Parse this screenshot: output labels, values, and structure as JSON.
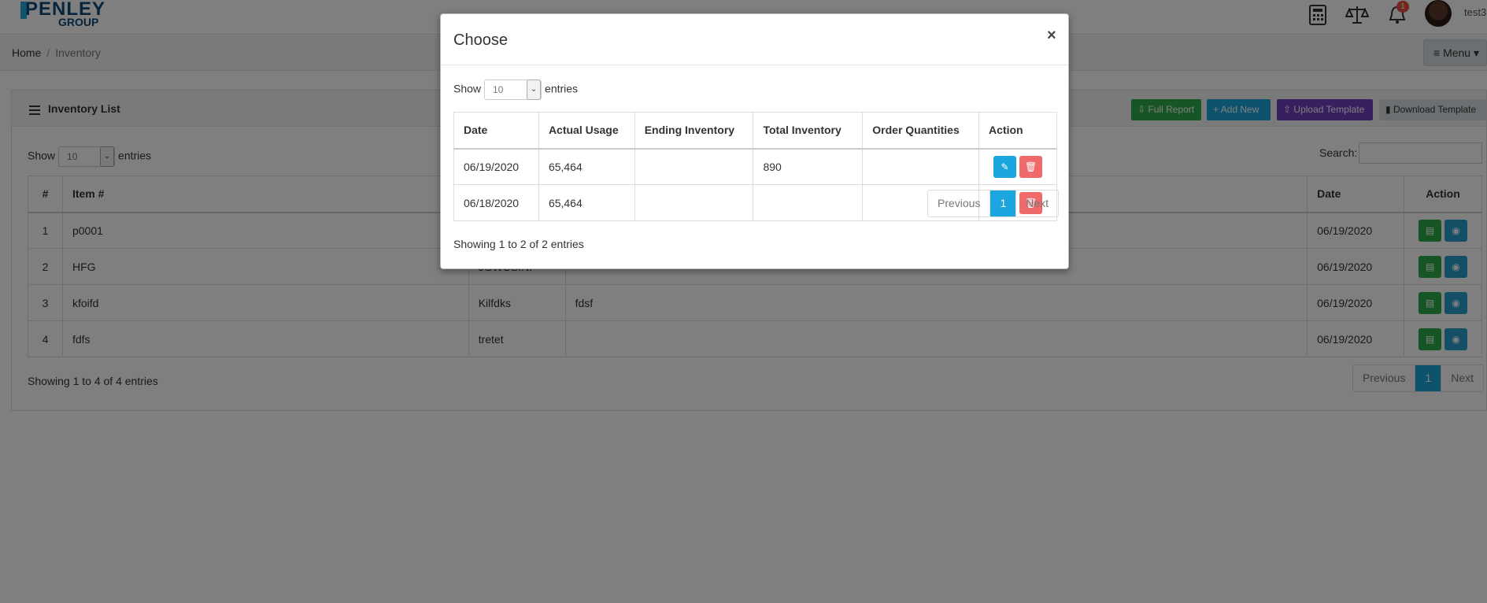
{
  "logo": {
    "line1": "PENLEY",
    "line2": "GROUP"
  },
  "header": {
    "notification_count": "1",
    "username": "test3"
  },
  "breadcrumb": {
    "home": "Home",
    "separator": "/",
    "current": "Inventory"
  },
  "menu": {
    "label": "Menu"
  },
  "panel": {
    "title": "Inventory List",
    "buttons": {
      "full_report": "Full Report",
      "add_new": "Add New",
      "upload_template": "Upload Template",
      "download_template": "Download Template"
    },
    "show_prefix": "Show",
    "show_value": "10",
    "show_suffix": "entries",
    "search_label": "Search:",
    "columns": {
      "num": "#",
      "item": "Item #",
      "date": "Date",
      "action": "Action"
    },
    "rows": [
      {
        "num": "1",
        "item": "p0001",
        "col3": "",
        "col4": "",
        "date": "06/19/2020"
      },
      {
        "num": "2",
        "item": "HFG",
        "col3": "JGWUSINI",
        "col4": "",
        "date": "06/19/2020"
      },
      {
        "num": "3",
        "item": "kfoifd",
        "col3": "Kilfdks",
        "col4": "fdsf",
        "date": "06/19/2020"
      },
      {
        "num": "4",
        "item": "fdfs",
        "col3": "tretet",
        "col4": "",
        "date": "06/19/2020"
      }
    ],
    "info": "Showing 1 to 4 of 4 entries",
    "pagination": {
      "previous": "Previous",
      "page": "1",
      "next": "Next"
    }
  },
  "modal": {
    "title": "Choose",
    "close": "×",
    "show_prefix": "Show",
    "show_value": "10",
    "show_suffix": "entries",
    "columns": {
      "date": "Date",
      "actual_usage": "Actual Usage",
      "ending_inventory": "Ending Inventory",
      "total_inventory": "Total Inventory",
      "order_quantities": "Order Quantities",
      "action": "Action"
    },
    "rows": [
      {
        "date": "06/19/2020",
        "actual_usage": "65,464",
        "ending_inventory": "",
        "total_inventory": "890",
        "order_quantities": ""
      },
      {
        "date": "06/18/2020",
        "actual_usage": "65,464",
        "ending_inventory": "",
        "total_inventory": "",
        "order_quantities": ""
      }
    ],
    "info": "Showing 1 to 2 of 2 entries",
    "pagination": {
      "previous": "Previous",
      "page": "1",
      "next": "Next"
    }
  },
  "colors": {
    "full_report": "#2eaa4a",
    "add_new": "#1ba7dd",
    "upload_template": "#6f3fc1",
    "download_template": "#d9dee3",
    "edit": "#1ba7dd",
    "delete": "#ef6b6b",
    "active_page": "#1ba7dd"
  }
}
